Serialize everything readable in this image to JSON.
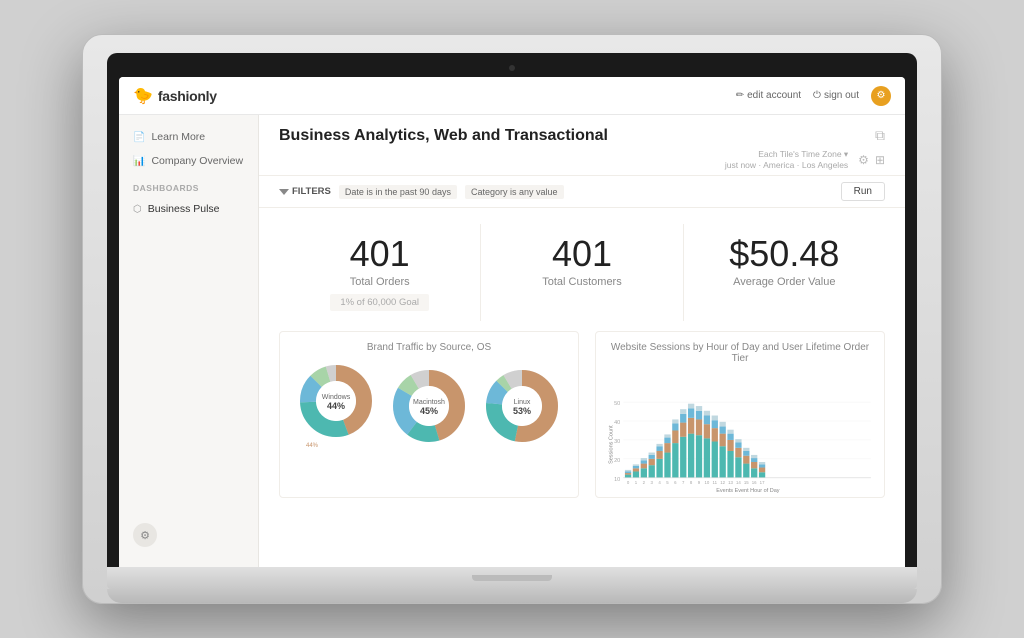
{
  "laptop": {
    "shown": true
  },
  "topbar": {
    "logo_bird": "🐦",
    "logo_text": "fashionly",
    "edit_account_label": "edit account",
    "sign_out_label": "sign out"
  },
  "sidebar": {
    "items": [
      {
        "id": "learn-more",
        "label": "Learn More",
        "icon": "📄"
      },
      {
        "id": "company-overview",
        "label": "Company Overview",
        "icon": "📊"
      }
    ],
    "dashboards_section": "DASHBOARDS",
    "dashboards_items": [
      {
        "id": "business-pulse",
        "label": "Business Pulse",
        "icon": "⬡",
        "active": true
      }
    ]
  },
  "content": {
    "page_title": "Business Analytics, Web and Transactional",
    "timezone_line1": "Each Tile's Time Zone ▾",
    "timezone_line2": "just now · America · Los Angeles",
    "filters": {
      "label": "FILTERS",
      "chips": [
        "Date is in the past 90 days",
        "Category is any value"
      ],
      "run_button": "Run"
    },
    "kpi_cards": [
      {
        "id": "total-orders",
        "number": "401",
        "label": "Total Orders",
        "sub": "1% of 60,000 Goal"
      },
      {
        "id": "total-customers",
        "number": "401",
        "label": "Total Customers"
      },
      {
        "id": "avg-order-value",
        "number": "$50.48",
        "label": "Average Order Value"
      }
    ],
    "brand_traffic_chart": {
      "title": "Brand Traffic by Source, OS",
      "donuts": [
        {
          "label": "Windows",
          "segments": [
            {
              "pct": 44,
              "color": "#c8956c"
            },
            {
              "pct": 30,
              "color": "#4db8b0"
            },
            {
              "pct": 13,
              "color": "#6db8d8"
            },
            {
              "pct": 8,
              "color": "#a0c8a0"
            },
            {
              "pct": 5,
              "color": "#d0d0d0"
            }
          ],
          "center_label": "Windows"
        },
        {
          "label": "Macintosh",
          "segments": [
            {
              "pct": 45,
              "color": "#c8956c"
            },
            {
              "pct": 15,
              "color": "#4db8b0"
            },
            {
              "pct": 23,
              "color": "#6db8d8"
            },
            {
              "pct": 8,
              "color": "#a0c8a0"
            },
            {
              "pct": 9,
              "color": "#d0d0d0"
            }
          ],
          "center_label": "Macintosh"
        },
        {
          "label": "Linux",
          "segments": [
            {
              "pct": 53,
              "color": "#c8956c"
            },
            {
              "pct": 23,
              "color": "#4db8b0"
            },
            {
              "pct": 11,
              "color": "#6db8d8"
            },
            {
              "pct": 4,
              "color": "#a0c8a0"
            },
            {
              "pct": 9,
              "color": "#d0d0d0"
            }
          ],
          "center_label": "Linux"
        }
      ]
    },
    "sessions_chart": {
      "title": "Website Sessions by Hour of Day and User Lifetime Order Tier",
      "y_axis_label": "Sessions Count",
      "x_axis_label": "Events  Event Hour of Day",
      "y_max": 50
    }
  }
}
